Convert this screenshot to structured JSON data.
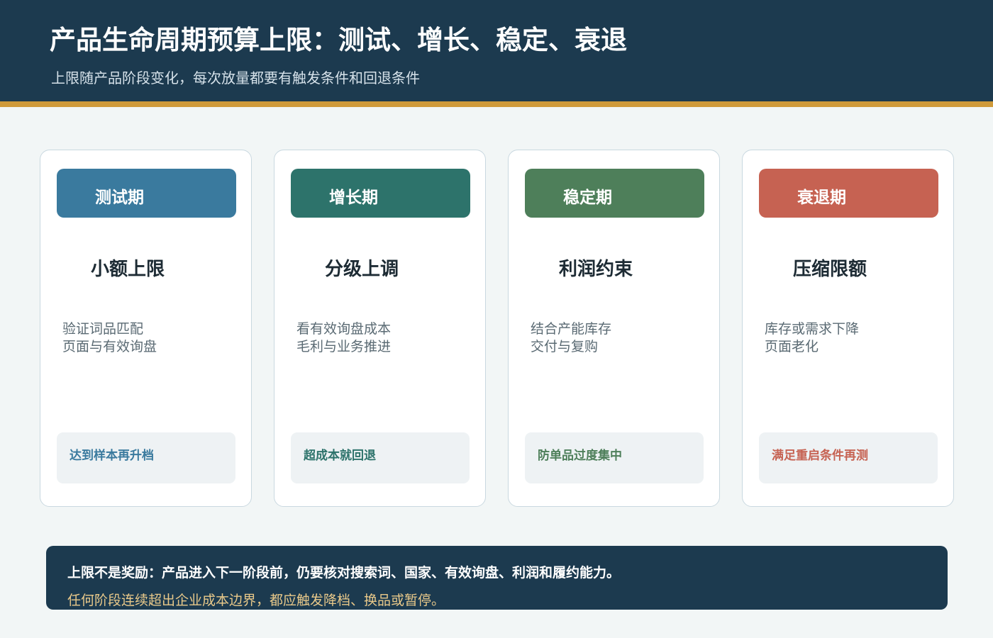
{
  "header": {
    "title": "产品生命周期预算上限：测试、增长、稳定、衰退",
    "subtitle": "上限随产品阶段变化，每次放量都要有触发条件和回退条件"
  },
  "stages": [
    {
      "label": "测试期",
      "heading": "小额上限",
      "desc_lines": [
        "验证词品匹配",
        "页面与有效询盘"
      ],
      "note": "达到样本再升档",
      "color": "#3a7a9e"
    },
    {
      "label": "增长期",
      "heading": "分级上调",
      "desc_lines": [
        "看有效询盘成本",
        "毛利与业务推进"
      ],
      "note": "超成本就回退",
      "color": "#2d736b"
    },
    {
      "label": "稳定期",
      "heading": "利润约束",
      "desc_lines": [
        "结合产能库存",
        "交付与复购"
      ],
      "note": "防单品过度集中",
      "color": "#4e7f5a"
    },
    {
      "label": "衰退期",
      "heading": "压缩限额",
      "desc_lines": [
        "库存或需求下降",
        "页面老化"
      ],
      "note": "满足重启条件再测",
      "color": "#c66252"
    }
  ],
  "footer": {
    "main": "上限不是奖励：产品进入下一阶段前，仍要核对搜索词、国家、有效询盘、利润和履约能力。",
    "sub": "任何阶段连续超出企业成本边界，都应触发降档、换品或暂停。"
  },
  "colors": {
    "header_bg": "#1c3a4f",
    "accent_rule": "#cf9a3a"
  }
}
